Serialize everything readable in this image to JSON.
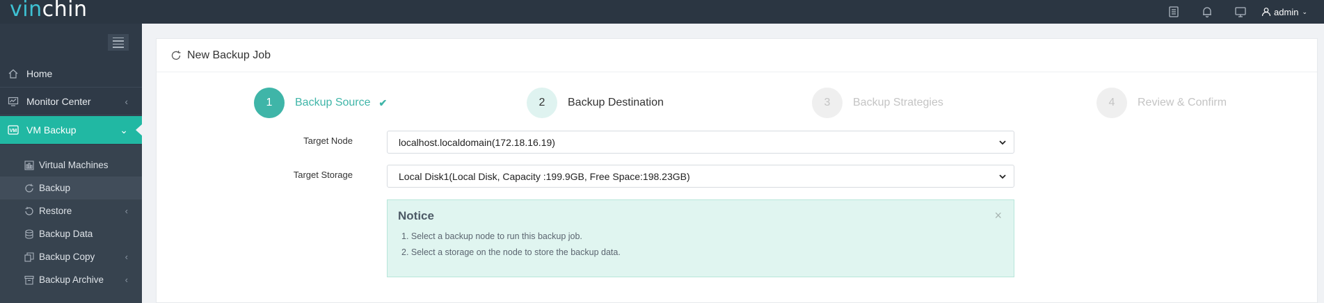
{
  "brand": {
    "logo_v": "vin",
    "logo_rest": "chin"
  },
  "topbar": {
    "icons": [
      "document-list-icon",
      "bell-icon",
      "monitor-icon"
    ],
    "user_label": "admin"
  },
  "sidebar": {
    "items": [
      {
        "label": "Home",
        "icon": "home-icon"
      },
      {
        "label": "Monitor Center",
        "icon": "monitor-chart-icon",
        "arrow": "‹"
      },
      {
        "label": "VM Backup",
        "icon": "vm-icon",
        "arrow": "⌄"
      }
    ],
    "sub_items": [
      {
        "label": "Virtual Machines",
        "icon": "virtual-machines-icon"
      },
      {
        "label": "Backup",
        "icon": "backup-refresh-icon"
      },
      {
        "label": "Restore",
        "icon": "restore-icon",
        "arrow": "‹"
      },
      {
        "label": "Backup Data",
        "icon": "database-icon"
      },
      {
        "label": "Backup Copy",
        "icon": "copy-icon",
        "arrow": "‹"
      },
      {
        "label": "Backup Archive",
        "icon": "archive-icon",
        "arrow": "‹"
      }
    ]
  },
  "page": {
    "title": "New Backup Job"
  },
  "steps": [
    {
      "number": "1",
      "label": "Backup Source",
      "state": "done",
      "check": "✔"
    },
    {
      "number": "2",
      "label": "Backup Destination",
      "state": "current"
    },
    {
      "number": "3",
      "label": "Backup Strategies",
      "state": "todo"
    },
    {
      "number": "4",
      "label": "Review & Confirm",
      "state": "todo"
    }
  ],
  "form": {
    "target_node_label": "Target Node",
    "target_node_value": "localhost.localdomain(172.18.16.19)",
    "target_storage_label": "Target Storage",
    "target_storage_value": "Local Disk1(Local Disk, Capacity :199.9GB, Free Space:198.23GB)"
  },
  "notice": {
    "title": "Notice",
    "close": "×",
    "lines": [
      "1. Select a backup node to run this backup job.",
      "2. Select a storage on the node to store the backup data."
    ]
  },
  "colors": {
    "topbar": "#2b3642",
    "sidebar": "#2f3a47",
    "accent": "#21b8a3",
    "step_done": "#3fb5a8",
    "notice_bg": "#e0f5f0"
  }
}
